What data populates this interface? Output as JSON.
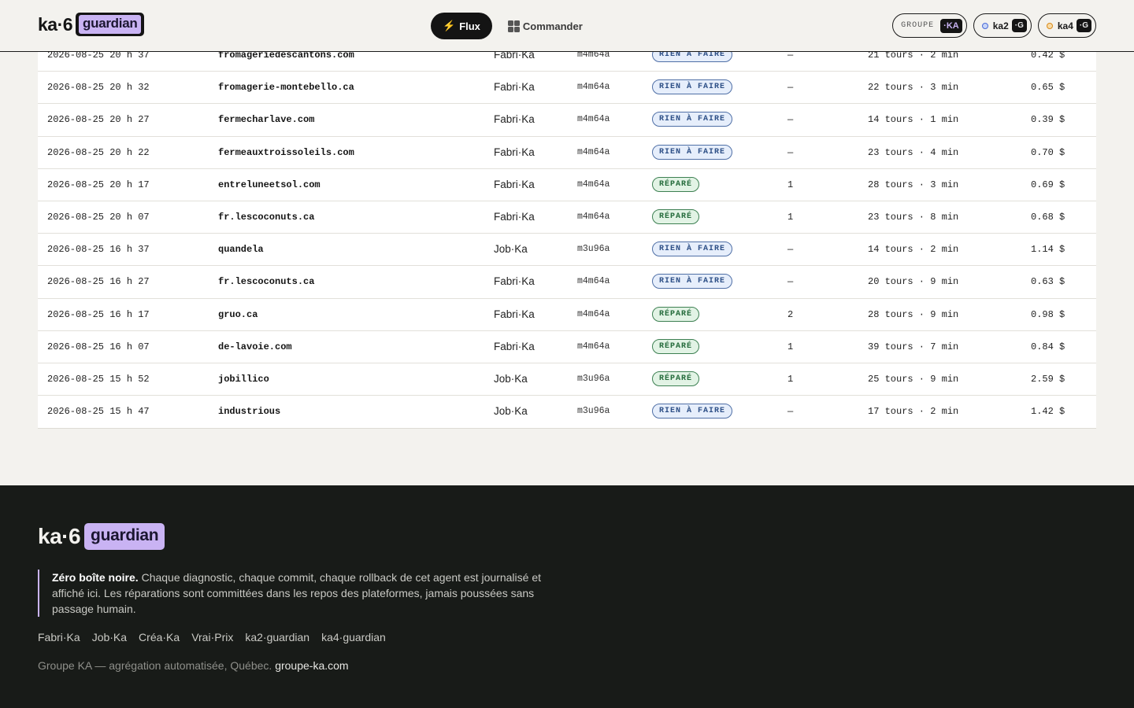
{
  "header": {
    "logo_text": "ka·6",
    "logo_badge": "guardian",
    "nav": {
      "flux_icon": "⚡",
      "flux_label": "Flux",
      "commander_label": "Commander"
    },
    "pills": {
      "groupe_label": "GROUPE",
      "groupe_tag": "·KA",
      "ka2_name": "ka2",
      "ka2_tag": "·G",
      "ka4_name": "ka4",
      "ka4_tag": "·G"
    }
  },
  "table": {
    "rows": [
      {
        "date": "2026-08-25 20 h 37",
        "domain": "fromageriedescantons.com",
        "platform": "Fabri·Ka",
        "model": "m4m64a",
        "status": "RIEN À FAIRE",
        "status_type": "rien",
        "count": "—",
        "tours": "21 tours · 2 min",
        "cost": "0.42 $"
      },
      {
        "date": "2026-08-25 20 h 32",
        "domain": "fromagerie-montebello.ca",
        "platform": "Fabri·Ka",
        "model": "m4m64a",
        "status": "RIEN À FAIRE",
        "status_type": "rien",
        "count": "—",
        "tours": "22 tours · 3 min",
        "cost": "0.65 $"
      },
      {
        "date": "2026-08-25 20 h 27",
        "domain": "fermecharlave.com",
        "platform": "Fabri·Ka",
        "model": "m4m64a",
        "status": "RIEN À FAIRE",
        "status_type": "rien",
        "count": "—",
        "tours": "14 tours · 1 min",
        "cost": "0.39 $"
      },
      {
        "date": "2026-08-25 20 h 22",
        "domain": "fermeauxtroissoleils.com",
        "platform": "Fabri·Ka",
        "model": "m4m64a",
        "status": "RIEN À FAIRE",
        "status_type": "rien",
        "count": "—",
        "tours": "23 tours · 4 min",
        "cost": "0.70 $"
      },
      {
        "date": "2026-08-25 20 h 17",
        "domain": "entreluneetsol.com",
        "platform": "Fabri·Ka",
        "model": "m4m64a",
        "status": "RÉPARÉ",
        "status_type": "repare",
        "count": "1",
        "tours": "28 tours · 3 min",
        "cost": "0.69 $"
      },
      {
        "date": "2026-08-25 20 h 07",
        "domain": "fr.lescoconuts.ca",
        "platform": "Fabri·Ka",
        "model": "m4m64a",
        "status": "RÉPARÉ",
        "status_type": "repare",
        "count": "1",
        "tours": "23 tours · 8 min",
        "cost": "0.68 $"
      },
      {
        "date": "2026-08-25 16 h 37",
        "domain": "quandela",
        "platform": "Job·Ka",
        "model": "m3u96a",
        "status": "RIEN À FAIRE",
        "status_type": "rien",
        "count": "—",
        "tours": "14 tours · 2 min",
        "cost": "1.14 $"
      },
      {
        "date": "2026-08-25 16 h 27",
        "domain": "fr.lescoconuts.ca",
        "platform": "Fabri·Ka",
        "model": "m4m64a",
        "status": "RIEN À FAIRE",
        "status_type": "rien",
        "count": "—",
        "tours": "20 tours · 9 min",
        "cost": "0.63 $"
      },
      {
        "date": "2026-08-25 16 h 17",
        "domain": "gruo.ca",
        "platform": "Fabri·Ka",
        "model": "m4m64a",
        "status": "RÉPARÉ",
        "status_type": "repare",
        "count": "2",
        "tours": "28 tours · 9 min",
        "cost": "0.98 $"
      },
      {
        "date": "2026-08-25 16 h 07",
        "domain": "de-lavoie.com",
        "platform": "Fabri·Ka",
        "model": "m4m64a",
        "status": "RÉPARÉ",
        "status_type": "repare",
        "count": "1",
        "tours": "39 tours · 7 min",
        "cost": "0.84 $"
      },
      {
        "date": "2026-08-25 15 h 52",
        "domain": "jobillico",
        "platform": "Job·Ka",
        "model": "m3u96a",
        "status": "RÉPARÉ",
        "status_type": "repare",
        "count": "1",
        "tours": "25 tours · 9 min",
        "cost": "2.59 $"
      },
      {
        "date": "2026-08-25 15 h 47",
        "domain": "industrious",
        "platform": "Job·Ka",
        "model": "m3u96a",
        "status": "RIEN À FAIRE",
        "status_type": "rien",
        "count": "—",
        "tours": "17 tours · 2 min",
        "cost": "1.42 $"
      }
    ]
  },
  "footer": {
    "logo_text": "ka·6",
    "logo_badge": "guardian",
    "quote_bold": "Zéro boîte noire.",
    "quote_text": " Chaque diagnostic, chaque commit, chaque rollback de cet agent est journalisé et affiché ici. Les réparations sont committées dans les repos des plateformes, jamais poussées sans passage humain.",
    "links": [
      "Fabri·Ka",
      "Job·Ka",
      "Créa·Ka",
      "Vrai·Prix",
      "ka2·guardian",
      "ka4·guardian"
    ],
    "copy_text": "Groupe KA — agrégation automatisée, Québec. ",
    "copy_link": "groupe-ka.com"
  },
  "colors": {
    "accent": "#c9b3f3",
    "dark": "#141414",
    "background": "#f3f2ee",
    "footer": "#181b18",
    "rien": "#2d4f86",
    "repare": "#236a3a"
  }
}
